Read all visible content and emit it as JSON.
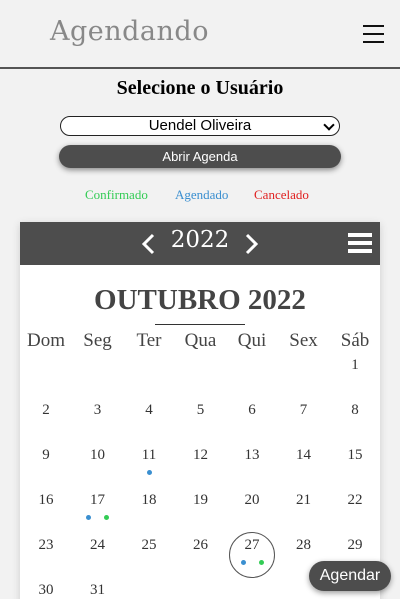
{
  "app": {
    "logo": "Agendando"
  },
  "title": "Selecione o Usuário",
  "user_select": {
    "value": "Uendel Oliveira"
  },
  "open_button": "Abrir Agenda",
  "legend": {
    "confirmed": {
      "label": "Confirmado",
      "color": "#33cc55"
    },
    "scheduled": {
      "label": "Agendado",
      "color": "#3a8fd0"
    },
    "canceled": {
      "label": "Cancelado",
      "color": "#e02020"
    }
  },
  "calendar": {
    "year": "2022",
    "month_title": "OUTUBRO 2022",
    "weekdays": [
      "Dom",
      "Seg",
      "Ter",
      "Qua",
      "Qui",
      "Sex",
      "Sáb"
    ],
    "today": "27",
    "days": [
      {
        "label": "1",
        "col": 6,
        "row": 0,
        "dots": []
      },
      {
        "label": "2",
        "col": 0,
        "row": 1,
        "dots": []
      },
      {
        "label": "3",
        "col": 1,
        "row": 1,
        "dots": []
      },
      {
        "label": "4",
        "col": 2,
        "row": 1,
        "dots": []
      },
      {
        "label": "5",
        "col": 3,
        "row": 1,
        "dots": []
      },
      {
        "label": "6",
        "col": 4,
        "row": 1,
        "dots": []
      },
      {
        "label": "7",
        "col": 5,
        "row": 1,
        "dots": []
      },
      {
        "label": "8",
        "col": 6,
        "row": 1,
        "dots": []
      },
      {
        "label": "9",
        "col": 0,
        "row": 2,
        "dots": []
      },
      {
        "label": "10",
        "col": 1,
        "row": 2,
        "dots": []
      },
      {
        "label": "11",
        "col": 2,
        "row": 2,
        "dots": [
          "scheduled"
        ]
      },
      {
        "label": "12",
        "col": 3,
        "row": 2,
        "dots": []
      },
      {
        "label": "13",
        "col": 4,
        "row": 2,
        "dots": []
      },
      {
        "label": "14",
        "col": 5,
        "row": 2,
        "dots": []
      },
      {
        "label": "15",
        "col": 6,
        "row": 2,
        "dots": []
      },
      {
        "label": "16",
        "col": 0,
        "row": 3,
        "dots": []
      },
      {
        "label": "17",
        "col": 1,
        "row": 3,
        "dots": [
          "scheduled",
          "confirmed"
        ]
      },
      {
        "label": "18",
        "col": 2,
        "row": 3,
        "dots": []
      },
      {
        "label": "19",
        "col": 3,
        "row": 3,
        "dots": []
      },
      {
        "label": "20",
        "col": 4,
        "row": 3,
        "dots": []
      },
      {
        "label": "21",
        "col": 5,
        "row": 3,
        "dots": []
      },
      {
        "label": "22",
        "col": 6,
        "row": 3,
        "dots": []
      },
      {
        "label": "23",
        "col": 0,
        "row": 4,
        "dots": []
      },
      {
        "label": "24",
        "col": 1,
        "row": 4,
        "dots": []
      },
      {
        "label": "25",
        "col": 2,
        "row": 4,
        "dots": []
      },
      {
        "label": "26",
        "col": 3,
        "row": 4,
        "dots": []
      },
      {
        "label": "27",
        "col": 4,
        "row": 4,
        "dots": [
          "scheduled",
          "confirmed"
        ]
      },
      {
        "label": "28",
        "col": 5,
        "row": 4,
        "dots": []
      },
      {
        "label": "29",
        "col": 6,
        "row": 4,
        "dots": []
      },
      {
        "label": "30",
        "col": 0,
        "row": 5,
        "dots": []
      },
      {
        "label": "31",
        "col": 1,
        "row": 5,
        "dots": []
      }
    ]
  },
  "schedule_button": "Agendar",
  "icons": {
    "menu": "hamburger-menu-icon",
    "prev": "chevron-left-icon",
    "next": "chevron-right-icon",
    "calendar_menu": "calendar-menu-icon",
    "select": "chevron-down-icon"
  }
}
